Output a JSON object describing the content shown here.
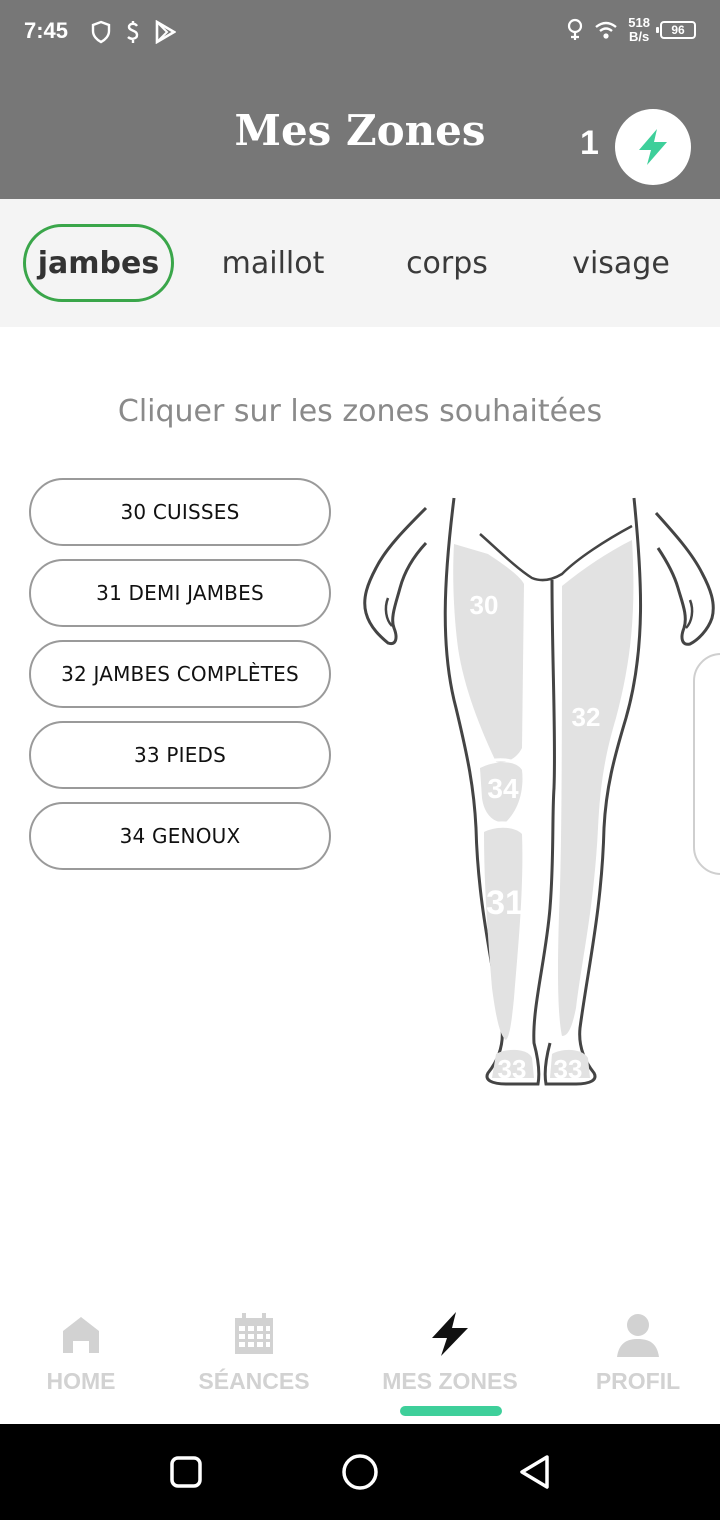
{
  "status_bar": {
    "time": "7:45",
    "net_speed_value": "518",
    "net_speed_unit": "B/s",
    "battery": "96"
  },
  "header": {
    "title": "Mes Zones",
    "credits": "1"
  },
  "tabs": [
    {
      "label": "jambes",
      "active": true
    },
    {
      "label": "maillot",
      "active": false
    },
    {
      "label": "corps",
      "active": false
    },
    {
      "label": "visage",
      "active": false
    }
  ],
  "instruction": "Cliquer sur les zones souhaitées",
  "zones": [
    {
      "label": "30 CUISSES"
    },
    {
      "label": "31 DEMI JAMBES"
    },
    {
      "label": "32 JAMBES COMPLÈTES"
    },
    {
      "label": "33 PIEDS"
    },
    {
      "label": "34 GENOUX"
    }
  ],
  "diagram_labels": {
    "z30": "30",
    "z31": "31",
    "z32": "32",
    "z33_left": "33",
    "z33_right": "33",
    "z34": "34"
  },
  "bottom_nav": [
    {
      "label": "HOME",
      "icon": "home-icon",
      "active": false
    },
    {
      "label": "SÉANCES",
      "icon": "calendar-icon",
      "active": false
    },
    {
      "label": "MES ZONES",
      "icon": "lightning-icon",
      "active": true
    },
    {
      "label": "PROFIL",
      "icon": "profile-icon",
      "active": false
    }
  ],
  "colors": {
    "header_bg": "#777777",
    "accent_green": "#3aa64a",
    "credit_icon": "#3ecf9a",
    "nav_indicator": "#3ecf9a"
  }
}
